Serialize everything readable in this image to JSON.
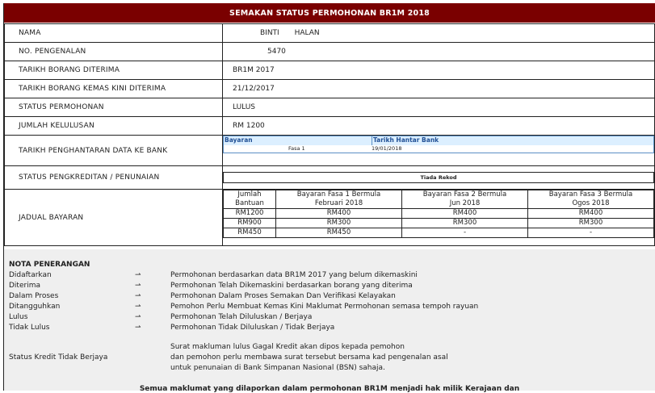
{
  "header": {
    "title": "SEMAKAN STATUS PERMOHONAN BR1M 2018"
  },
  "rows": [
    {
      "label": "NAMA",
      "value_a": "BINTI",
      "value_b": "HALAN"
    },
    {
      "label": "NO. PENGENALAN",
      "value": "5470"
    },
    {
      "label": "TARIKH BORANG DITERIMA",
      "value": "BR1M 2017"
    },
    {
      "label": "TARIKH BORANG KEMAS KINI DITERIMA",
      "value": "21/12/2017"
    },
    {
      "label": "STATUS PERMOHONAN",
      "value": "LULUS"
    },
    {
      "label": "JUMLAH KELULUSAN",
      "value": "RM 1200"
    }
  ],
  "bank": {
    "label": "TARIKH PENGHANTARAN DATA KE BANK",
    "col1": "Bayaran",
    "col2": "Tarikh Hantar Bank",
    "row_fasa": "Fasa 1",
    "row_date": "19/01/2018"
  },
  "kredit": {
    "label": "STATUS PENGKREDITAN / PENUNAIAN",
    "value": "Tiada Rekod"
  },
  "jadual": {
    "label": "JADUAL BAYARAN",
    "headers": [
      [
        "Jumlah",
        "Bantuan"
      ],
      [
        "Bayaran Fasa 1 Bermula",
        "Februari 2018"
      ],
      [
        "Bayaran Fasa 2 Bermula",
        "Jun 2018"
      ],
      [
        "Bayaran Fasa 3 Bermula",
        "Ogos 2018"
      ]
    ],
    "rows": [
      [
        "RM1200",
        "RM400",
        "RM400",
        "RM400"
      ],
      [
        "RM900",
        "RM300",
        "RM300",
        "RM300"
      ],
      [
        "RM450",
        "RM450",
        "-",
        "-"
      ]
    ]
  },
  "notes": {
    "title": "NOTA PENERANGAN",
    "arrow": "⇀",
    "items": [
      {
        "k": "Didaftarkan",
        "d": "Permohonan berdasarkan data BR1M 2017 yang belum dikemaskini"
      },
      {
        "k": "Diterima",
        "d": "Permohonan Telah Dikemaskini berdasarkan borang yang diterima"
      },
      {
        "k": "Dalam Proses",
        "d": "Permohonan Dalam Proses Semakan Dan Verifikasi Kelayakan"
      },
      {
        "k": "Ditangguhkan",
        "d": "Pemohon Perlu Membuat Kemas Kini Maklumat Permohonan semasa tempoh rayuan"
      },
      {
        "k": "Lulus",
        "d": "Permohonan Telah Diluluskan / Berjaya"
      },
      {
        "k": "Tidak Lulus",
        "d": "Permohonan Tidak Diluluskan / Tidak Berjaya"
      }
    ],
    "kredit_label": "Status Kredit Tidak Berjaya",
    "kredit_lines": [
      "Surat makluman lulus Gagal Kredit akan dipos kepada pemohon",
      "dan pemohon perlu membawa surat tersebut bersama kad pengenalan asal",
      "untuk penunaian di Bank Simpanan Nasional (BSN) sahaja."
    ],
    "footer": "Semua maklumat yang dilaporkan dalam permohonan BR1M menjadi hak milik Kerajaan dan"
  }
}
